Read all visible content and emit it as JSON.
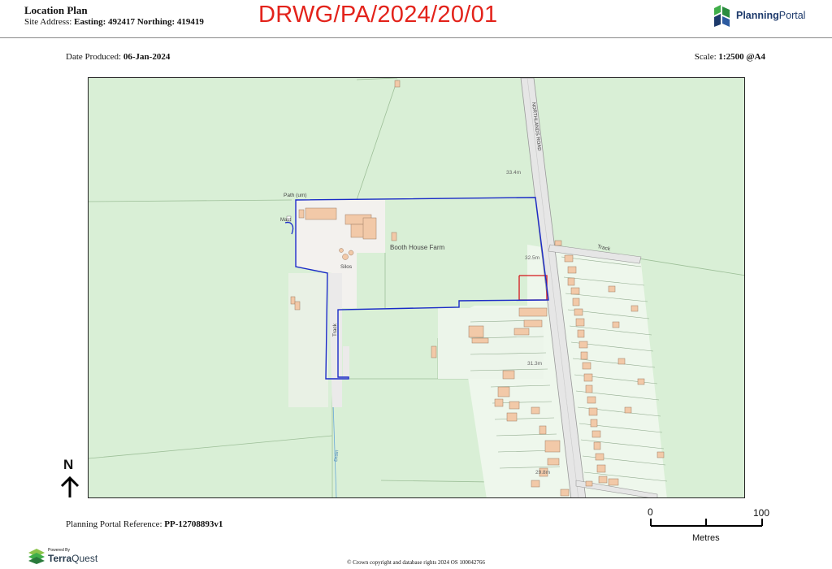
{
  "header": {
    "title": "Location Plan",
    "site_address_label": "Site Address:",
    "site_address_value": "Easting: 492417 Northing: 419419",
    "drawing_number": "DRWG/PA/2024/20/01"
  },
  "logo": {
    "name_bold": "Planning",
    "name_regular": "Portal",
    "icon": "planning-portal-logo",
    "colors": {
      "green": "#3fae49",
      "blue": "#1d3a6b"
    }
  },
  "meta": {
    "date_label": "Date Produced:",
    "date_value": "06-Jan-2024",
    "scale_label": "Scale:",
    "scale_value": "1:2500 @A4"
  },
  "map": {
    "labels": {
      "road": "NORTHLANDS ROAD",
      "path": "Path (um)",
      "farm": "Booth House Farm",
      "silos": "Silos",
      "track_west": "Track",
      "track_east": "Track",
      "drain": "Drain",
      "mast": "Mast",
      "height_1": "33.4m",
      "height_2": "32.5m",
      "height_3": "31.3m",
      "height_4": "29.8m"
    },
    "colors": {
      "field": "#d9efd6",
      "site_boundary": "#1a2bc7",
      "red_boundary": "#d4151b",
      "building": "#f2c9a8",
      "road": "#e6e6e6"
    }
  },
  "north": {
    "label": "N",
    "icon": "north-arrow-icon"
  },
  "footer": {
    "reference_label": "Planning Portal Reference:",
    "reference_value": "PP-12708893v1",
    "scalebar": {
      "start": "0",
      "end": "100",
      "unit": "Metres"
    },
    "powered_by": "Powered By",
    "terra_bold": "Terra",
    "terra_regular": "Quest",
    "copyright": "© Crown copyright and database rights 2024 OS 100042766"
  }
}
